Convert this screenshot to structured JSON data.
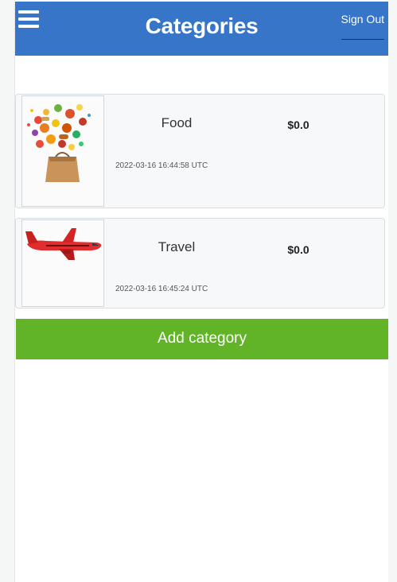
{
  "header": {
    "title": "Categories",
    "signout_label": "Sign Out",
    "menu_icon": "hamburger-menu-icon"
  },
  "categories": [
    {
      "name": "Food",
      "amount": "$0.0",
      "created_at": "2022-03-16 16:44:58 UTC",
      "image_icon": "food-bag-icon"
    },
    {
      "name": "Travel",
      "amount": "$0.0",
      "created_at": "2022-03-16 16:45:24 UTC",
      "image_icon": "airplane-icon"
    }
  ],
  "add_button_label": "Add category",
  "colors": {
    "header_bg": "#3675c8",
    "add_button_bg": "#61b427",
    "card_bg": "#f7f8fa"
  }
}
